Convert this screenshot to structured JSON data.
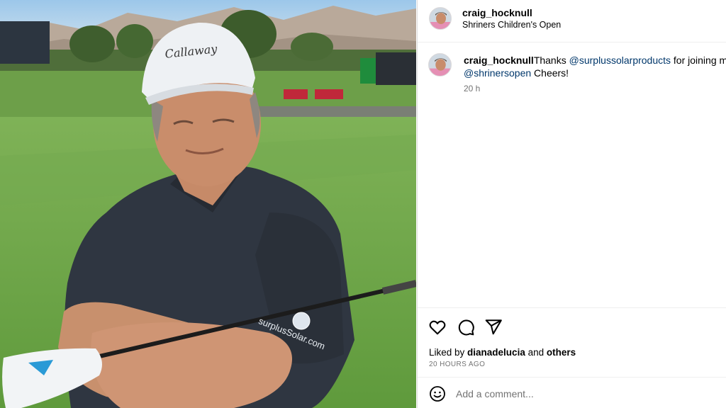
{
  "photo": {
    "alt_icon": "photo-golfer",
    "cap_brand": "Callaway",
    "sleeve_brand": "surplusSolar.com"
  },
  "post_header": {
    "username": "craig_hocknull",
    "location": "Shriners Children's Open",
    "avatar_icon": "user-avatar"
  },
  "caption": {
    "username": "craig_hocknull",
    "text_before": "Thanks ",
    "mention_1": "@surplussolarproducts",
    "text_middle": " for joining me",
    "mention_2": "@shrinersopen",
    "text_after": " Cheers!",
    "time": "20 h"
  },
  "actions": {
    "like_icon": "heart-icon",
    "comment_icon": "comment-icon",
    "share_icon": "send-icon"
  },
  "likes": {
    "prefix": "Liked by ",
    "user": "dianadelucia",
    "middle": " and ",
    "others": "others"
  },
  "post_age": "20 HOURS AGO",
  "comment": {
    "placeholder": "Add a comment...",
    "emoji_icon": "emoji-icon"
  },
  "colors": {
    "mention": "#00376b",
    "secondary_text": "#737373",
    "divider": "#efefef"
  }
}
